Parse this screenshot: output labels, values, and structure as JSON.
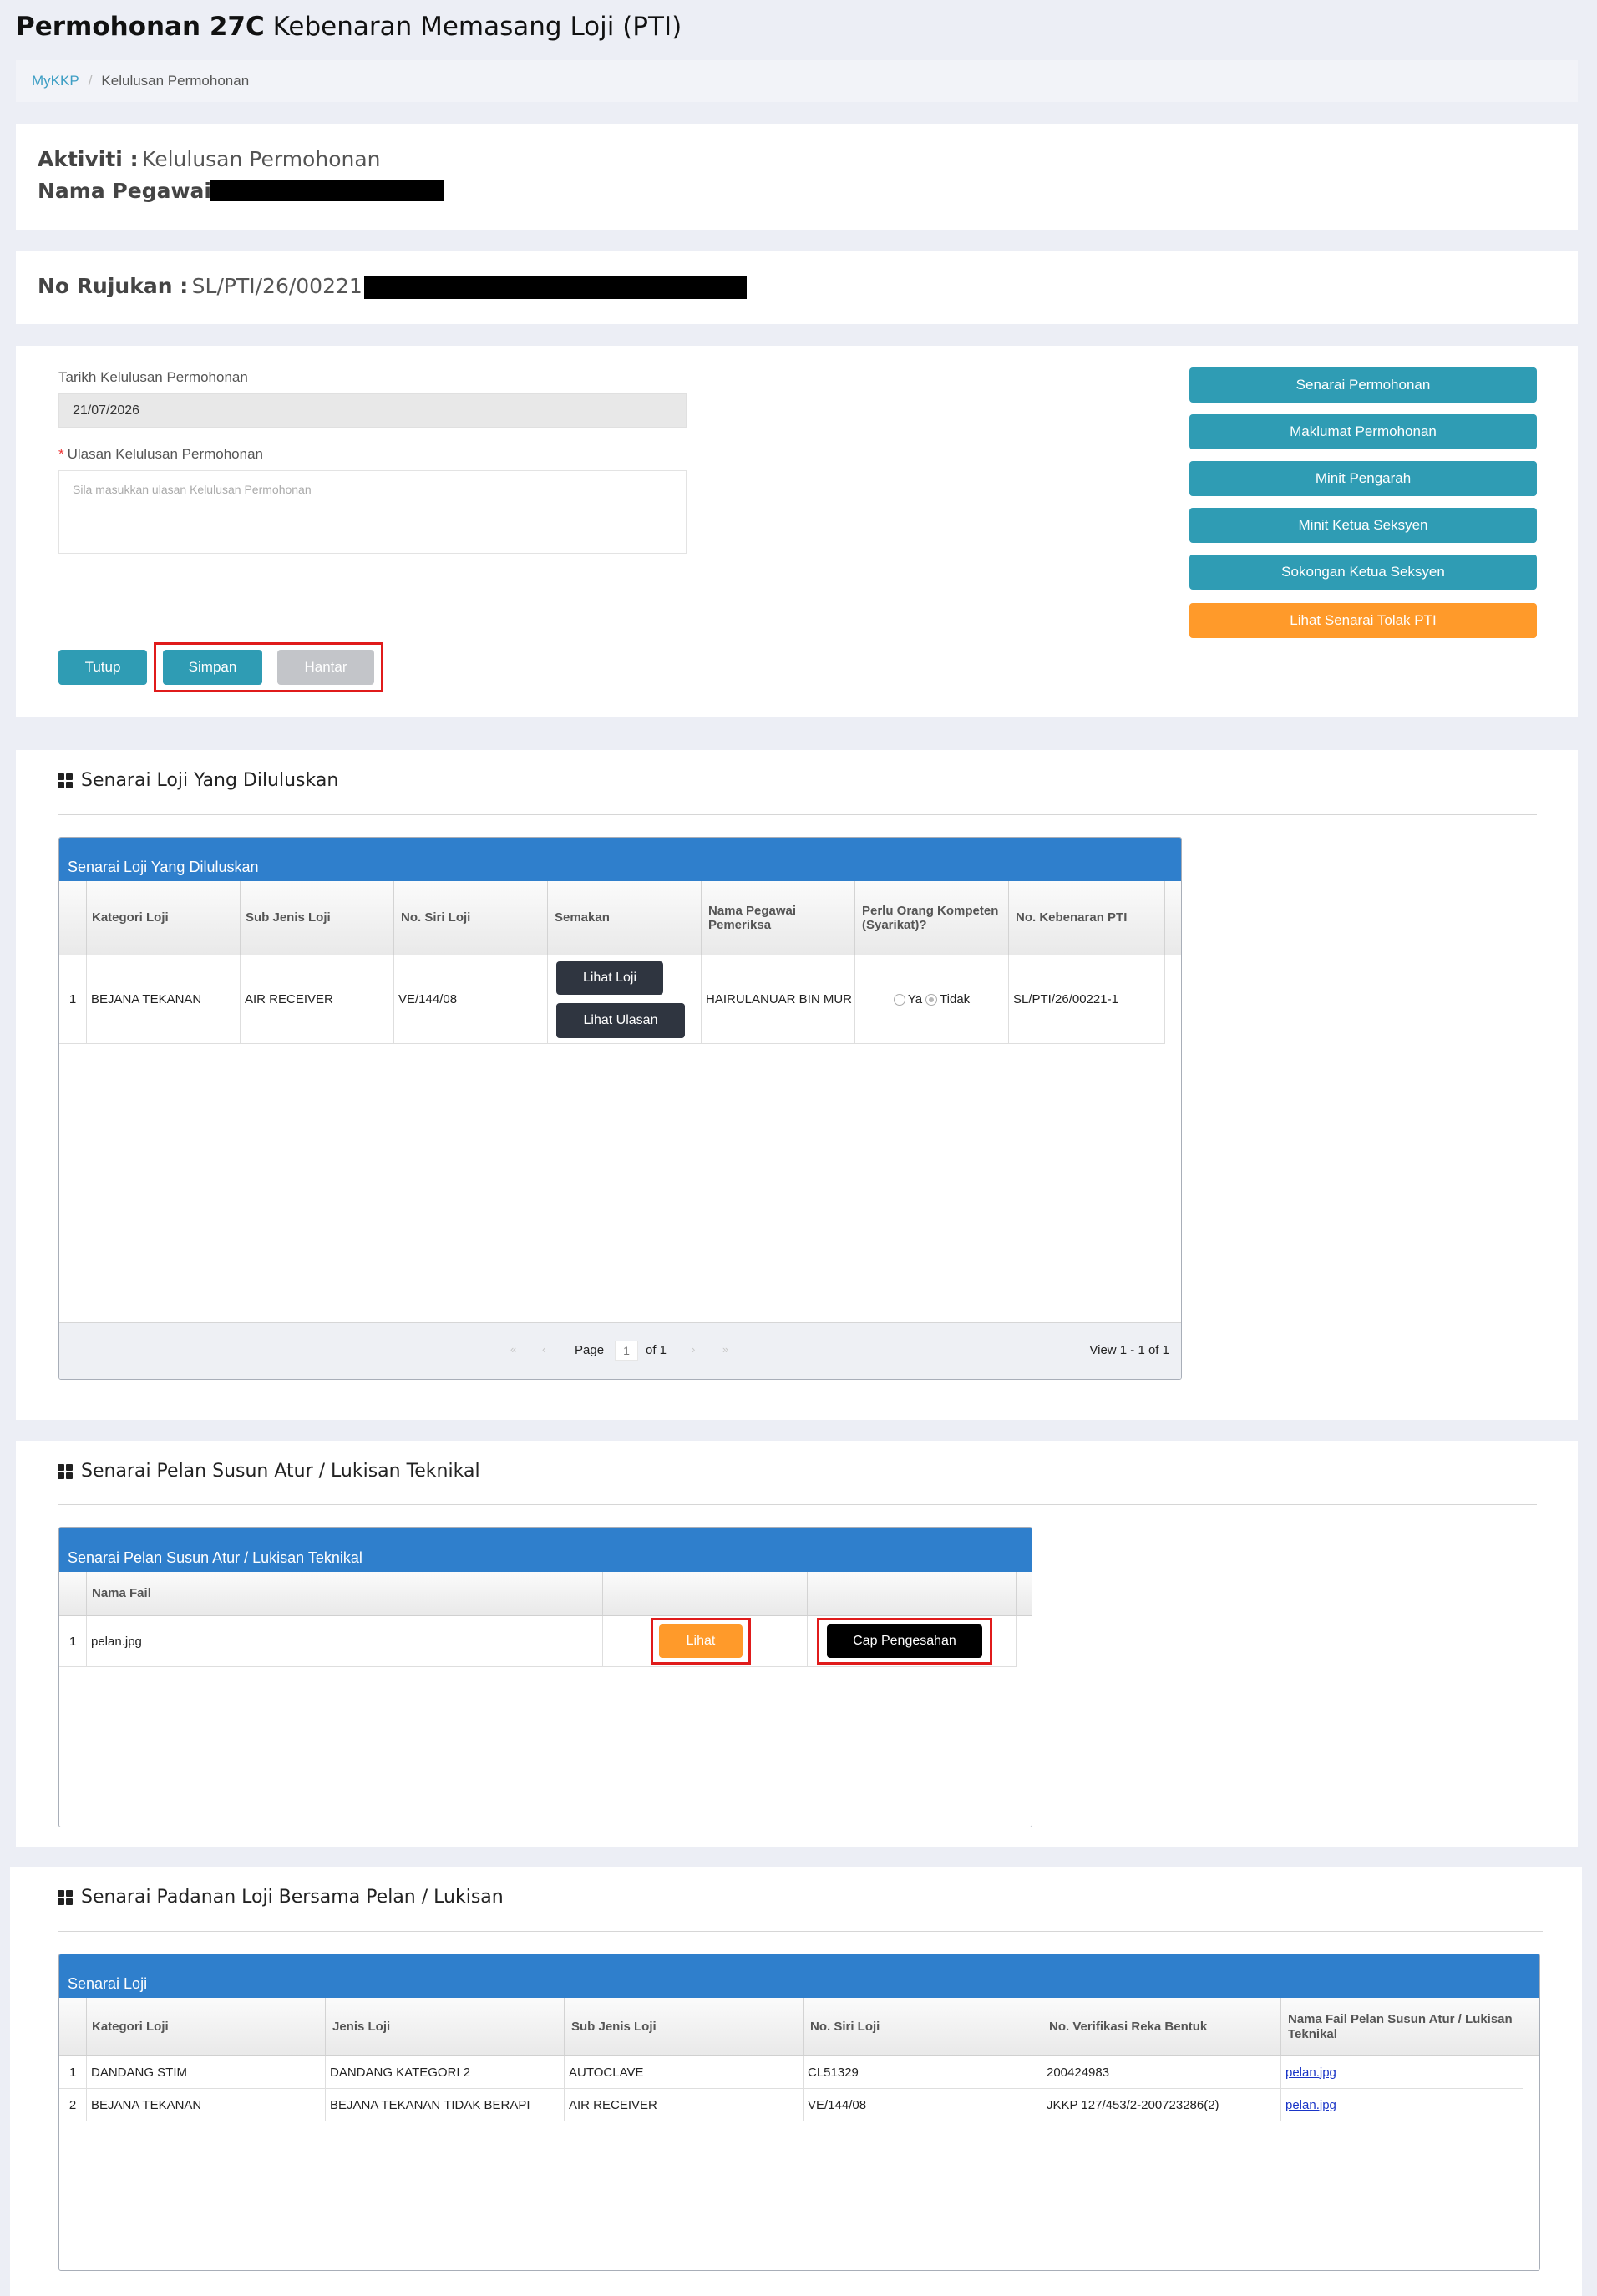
{
  "header": {
    "title_bold": "Permohonan 27C",
    "title_rest": "Kebenaran Memasang Loji (PTI)"
  },
  "breadcrumb": {
    "home": "MyKKP",
    "separator": "/",
    "current": "Kelulusan Permohonan"
  },
  "activity": {
    "aktiviti_label": "Aktiviti :",
    "aktiviti_value": "Kelulusan Permohonan",
    "pegawai_label": "Nama Pegawai :"
  },
  "reference": {
    "label": "No Rujukan :",
    "value": "SL/PTI/26/00221:"
  },
  "form": {
    "date_label": "Tarikh Kelulusan Permohonan",
    "date_value": "21/07/2026",
    "required_mark": "*",
    "ulasan_label": "Ulasan Kelulusan Permohonan",
    "ulasan_placeholder": "Sila masukkan ulasan Kelulusan Permohonan",
    "btn_tutup": "Tutup",
    "btn_simpan": "Simpan",
    "btn_hantar": "Hantar"
  },
  "side_buttons": {
    "senarai_permohonan": "Senarai Permohonan",
    "maklumat_permohonan": "Maklumat Permohonan",
    "minit_pengarah": "Minit Pengarah",
    "minit_ketua_seksyen": "Minit Ketua Seksyen",
    "sokongan_ketua_seksyen": "Sokongan Ketua Seksyen",
    "lihat_senarai_tolak": "Lihat Senarai Tolak PTI"
  },
  "section1": {
    "title": "Senarai Loji Yang Diluluskan",
    "grid_caption": "Senarai Loji Yang Diluluskan",
    "headers": [
      "Kategori Loji",
      "Sub Jenis Loji",
      "No. Siri Loji",
      "Semakan",
      "Nama Pegawai Pemeriksa",
      "Perlu Orang Kompeten (Syarikat)?",
      "No. Kebenaran PTI"
    ],
    "row": {
      "num": "1",
      "kategori": "BEJANA TEKANAN",
      "sub_jenis": "AIR RECEIVER",
      "no_siri": "VE/144/08",
      "btn_lihat_loji": "Lihat Loji",
      "btn_lihat_ulasan": "Lihat Ulasan",
      "pegawai": "HAIRULANUAR BIN MUR",
      "opt_ya": "Ya",
      "opt_tidak": "Tidak",
      "selected": "Tidak",
      "kebenaran": "SL/PTI/26/00221-1"
    },
    "pager": {
      "page_label": "Page",
      "page_value": "1",
      "of_label": "of 1",
      "view_label": "View 1 - 1 of 1"
    }
  },
  "section2": {
    "title": "Senarai Pelan Susun Atur / Lukisan Teknikal",
    "grid_caption": "Senarai Pelan Susun Atur / Lukisan Teknikal",
    "headers": [
      "Nama Fail",
      "",
      ""
    ],
    "row": {
      "num": "1",
      "file": "pelan.jpg",
      "btn_lihat": "Lihat",
      "btn_cap": "Cap Pengesahan"
    }
  },
  "section3": {
    "title": "Senarai Padanan Loji Bersama Pelan / Lukisan",
    "grid_caption": "Senarai Loji",
    "headers": [
      "Kategori Loji",
      "Jenis Loji",
      "Sub Jenis Loji",
      "No. Siri Loji",
      "No. Verifikasi Reka Bentuk",
      "Nama Fail Pelan Susun Atur / Lukisan Teknikal"
    ],
    "rows": [
      {
        "num": "1",
        "kategori": "DANDANG STIM",
        "jenis": "DANDANG KATEGORI 2",
        "sub_jenis": "AUTOCLAVE",
        "no_siri": "CL51329",
        "verifikasi": "200424983",
        "fail": "pelan.jpg"
      },
      {
        "num": "2",
        "kategori": "BEJANA TEKANAN",
        "jenis": "BEJANA TEKANAN TIDAK BERAPI",
        "sub_jenis": "AIR RECEIVER",
        "no_siri": "VE/144/08",
        "verifikasi": "JKKP 127/453/2-200723286(2)",
        "fail": "pelan.jpg"
      }
    ]
  },
  "colors": {
    "teal": "#2f9cb4",
    "orange": "#ff9a2a",
    "grid_header_blue": "#2f7fcc",
    "highlight_red": "#e01b1b"
  }
}
